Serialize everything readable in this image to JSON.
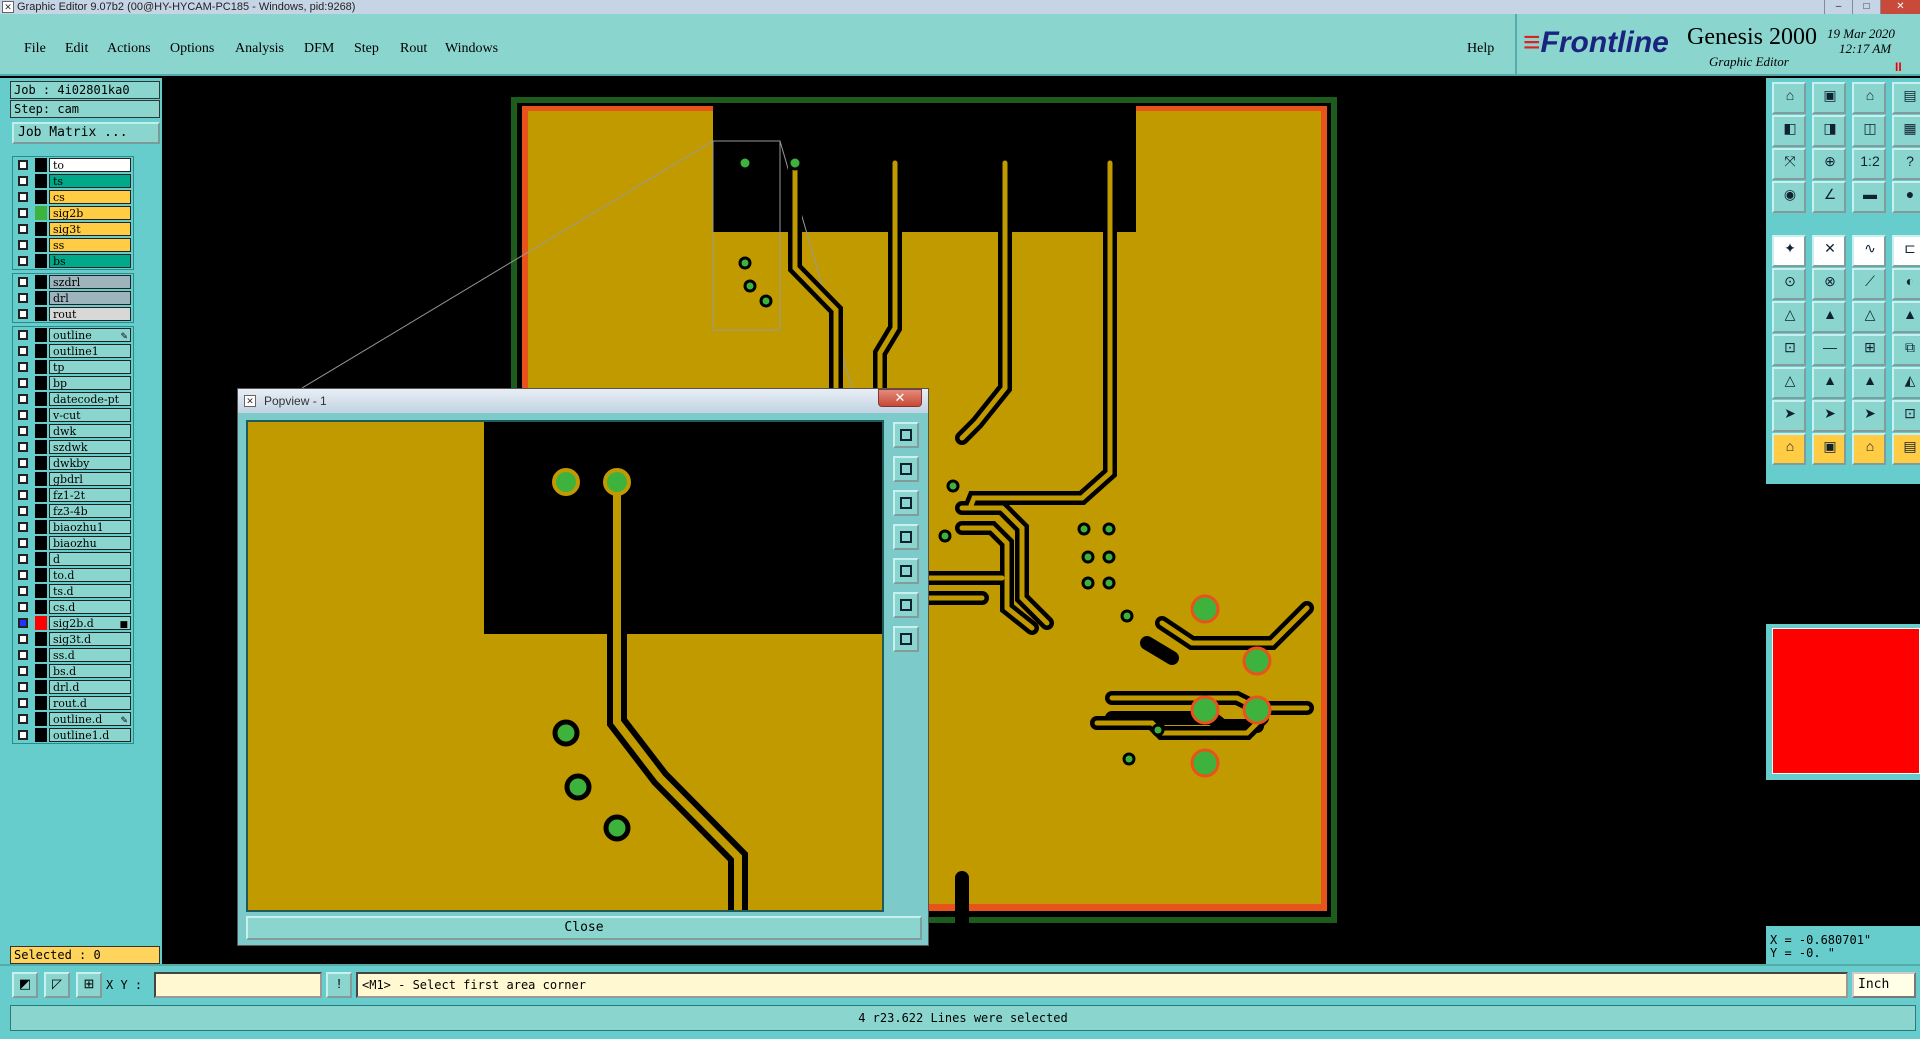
{
  "window": {
    "title": "Graphic Editor 9.07b2 (00@HY-HYCAM-PC185 - Windows, pid:9268)",
    "icon": "app-x-icon"
  },
  "menu": {
    "items": [
      "File",
      "Edit",
      "Actions",
      "Options",
      "Analysis",
      "DFM",
      "Step",
      "Rout",
      "Windows"
    ],
    "help": "Help"
  },
  "brand": {
    "logo": "Frontline",
    "name": "Genesis 2000",
    "subtitle": "Graphic Editor",
    "date": "19 Mar 2020",
    "time": "12:17 AM",
    "pause": "II"
  },
  "job": {
    "job_label": "Job : 4i02801ka0",
    "step_label": "Step: cam",
    "matrix_button": "Job Matrix ..."
  },
  "layers": {
    "group1": [
      {
        "name": "to",
        "color": "#ffffff",
        "indicator": "#000000",
        "checked": false
      },
      {
        "name": "ts",
        "color": "#00a98a",
        "indicator": "#000000",
        "checked": false
      },
      {
        "name": "cs",
        "color": "#ffcc44",
        "indicator": "#000000",
        "checked": false
      },
      {
        "name": "sig2b",
        "color": "#ffcc44",
        "indicator": "#3db33d",
        "checked": false
      },
      {
        "name": "sig3t",
        "color": "#ffcc44",
        "indicator": "#000000",
        "checked": false
      },
      {
        "name": "ss",
        "color": "#ffcc44",
        "indicator": "#000000",
        "checked": false
      },
      {
        "name": "bs",
        "color": "#00a98a",
        "indicator": "#000000",
        "checked": false
      }
    ],
    "group2": [
      {
        "name": "szdrl",
        "color": "#9db4bd",
        "indicator": "#000000",
        "checked": false
      },
      {
        "name": "drl",
        "color": "#9db4bd",
        "indicator": "#000000",
        "checked": false
      },
      {
        "name": "rout",
        "color": "#d8d8d8",
        "indicator": "#000000",
        "checked": false
      }
    ],
    "group3": [
      {
        "name": "outline",
        "color": "#8ad6cf",
        "indicator": "#000000",
        "checked": false,
        "mark": "✎"
      },
      {
        "name": "outline1",
        "color": "#8ad6cf",
        "indicator": "#000000",
        "checked": false
      },
      {
        "name": "tp",
        "color": "#8ad6cf",
        "indicator": "#000000",
        "checked": false
      },
      {
        "name": "bp",
        "color": "#8ad6cf",
        "indicator": "#000000",
        "checked": false
      },
      {
        "name": "datecode-pt",
        "color": "#8ad6cf",
        "indicator": "#000000",
        "checked": false
      },
      {
        "name": "v-cut",
        "color": "#8ad6cf",
        "indicator": "#000000",
        "checked": false
      },
      {
        "name": "dwk",
        "color": "#8ad6cf",
        "indicator": "#000000",
        "checked": false
      },
      {
        "name": "szdwk",
        "color": "#8ad6cf",
        "indicator": "#000000",
        "checked": false
      },
      {
        "name": "dwkby",
        "color": "#8ad6cf",
        "indicator": "#000000",
        "checked": false
      },
      {
        "name": "gbdrl",
        "color": "#8ad6cf",
        "indicator": "#000000",
        "checked": false
      },
      {
        "name": "fz1-2t",
        "color": "#8ad6cf",
        "indicator": "#000000",
        "checked": false
      },
      {
        "name": "fz3-4b",
        "color": "#8ad6cf",
        "indicator": "#000000",
        "checked": false
      },
      {
        "name": "biaozhu1",
        "color": "#8ad6cf",
        "indicator": "#000000",
        "checked": false
      },
      {
        "name": "biaozhu",
        "color": "#8ad6cf",
        "indicator": "#000000",
        "checked": false
      },
      {
        "name": "d",
        "color": "#8ad6cf",
        "indicator": "#000000",
        "checked": false
      },
      {
        "name": "to.d",
        "color": "#8ad6cf",
        "indicator": "#000000",
        "checked": false
      },
      {
        "name": "ts.d",
        "color": "#8ad6cf",
        "indicator": "#000000",
        "checked": false
      },
      {
        "name": "cs.d",
        "color": "#8ad6cf",
        "indicator": "#000000",
        "checked": false
      },
      {
        "name": "sig2b.d",
        "color": "#8ad6cf",
        "indicator": "#ff0000",
        "checked": true,
        "mark": "■"
      },
      {
        "name": "sig3t.d",
        "color": "#8ad6cf",
        "indicator": "#000000",
        "checked": false
      },
      {
        "name": "ss.d",
        "color": "#8ad6cf",
        "indicator": "#000000",
        "checked": false
      },
      {
        "name": "bs.d",
        "color": "#8ad6cf",
        "indicator": "#000000",
        "checked": false
      },
      {
        "name": "drl.d",
        "color": "#8ad6cf",
        "indicator": "#000000",
        "checked": false
      },
      {
        "name": "rout.d",
        "color": "#8ad6cf",
        "indicator": "#000000",
        "checked": false
      },
      {
        "name": "outline.d",
        "color": "#8ad6cf",
        "indicator": "#000000",
        "checked": false,
        "mark": "✎"
      },
      {
        "name": "outline1.d",
        "color": "#8ad6cf",
        "indicator": "#000000",
        "checked": false
      }
    ]
  },
  "selected": "Selected : 0",
  "popview": {
    "title": "Popview - 1",
    "close_label": "Close",
    "close_icon": "close-x-icon",
    "window_close": "✕"
  },
  "coords": {
    "x": "X = -0.680701\"",
    "y": "Y = -0.   \""
  },
  "command": {
    "xy_label": "X Y :",
    "xy_value": "",
    "prompt": "<M1> - Select first area corner",
    "units": "Inch"
  },
  "status": "4 r23.622 Lines were selected",
  "colors": {
    "copper": "#c19a00",
    "background": "#000000",
    "outline": "#e8531c",
    "pad": "#3db33d",
    "panel": "#66cccc",
    "menu": "#8ad6cf"
  }
}
